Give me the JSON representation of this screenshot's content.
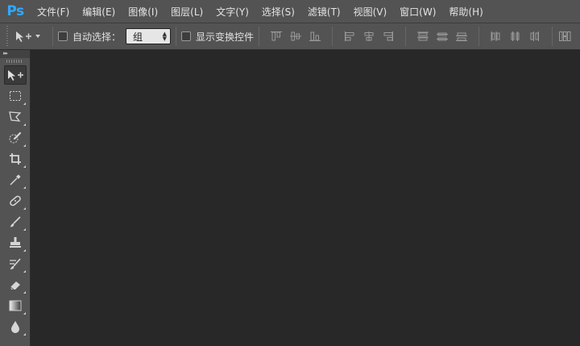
{
  "app": {
    "logo_text": "Ps"
  },
  "menu": [
    {
      "label": "文件(F)"
    },
    {
      "label": "编辑(E)"
    },
    {
      "label": "图像(I)"
    },
    {
      "label": "图层(L)"
    },
    {
      "label": "文字(Y)"
    },
    {
      "label": "选择(S)"
    },
    {
      "label": "滤镜(T)"
    },
    {
      "label": "视图(V)"
    },
    {
      "label": "窗口(W)"
    },
    {
      "label": "帮助(H)"
    }
  ],
  "options": {
    "auto_select_label": "自动选择：",
    "auto_select_checked": false,
    "auto_select_value": "组",
    "show_transform_label": "显示变换控件",
    "show_transform_checked": false
  },
  "toolbar": {
    "collapse_glyph": "▸▸",
    "tools": [
      {
        "name": "move-tool",
        "icon": "move-icon",
        "active": true
      },
      {
        "name": "rectangular-marquee-tool",
        "icon": "marquee-icon"
      },
      {
        "name": "polygonal-lasso-tool",
        "icon": "lasso-icon"
      },
      {
        "name": "quick-selection-tool",
        "icon": "quick-selection-icon"
      },
      {
        "name": "crop-tool",
        "icon": "crop-icon"
      },
      {
        "name": "eyedropper-tool",
        "icon": "eyedropper-icon"
      },
      {
        "name": "spot-healing-tool",
        "icon": "bandage-icon"
      },
      {
        "name": "brush-tool",
        "icon": "brush-icon"
      },
      {
        "name": "clone-stamp-tool",
        "icon": "stamp-icon"
      },
      {
        "name": "history-brush-tool",
        "icon": "history-brush-icon"
      },
      {
        "name": "eraser-tool",
        "icon": "eraser-icon"
      },
      {
        "name": "gradient-tool",
        "icon": "gradient-icon"
      },
      {
        "name": "blur-tool",
        "icon": "drop-icon"
      }
    ]
  },
  "colors": {
    "panel": "#535353",
    "workspace": "#282828",
    "logo": "#31a8ff"
  }
}
